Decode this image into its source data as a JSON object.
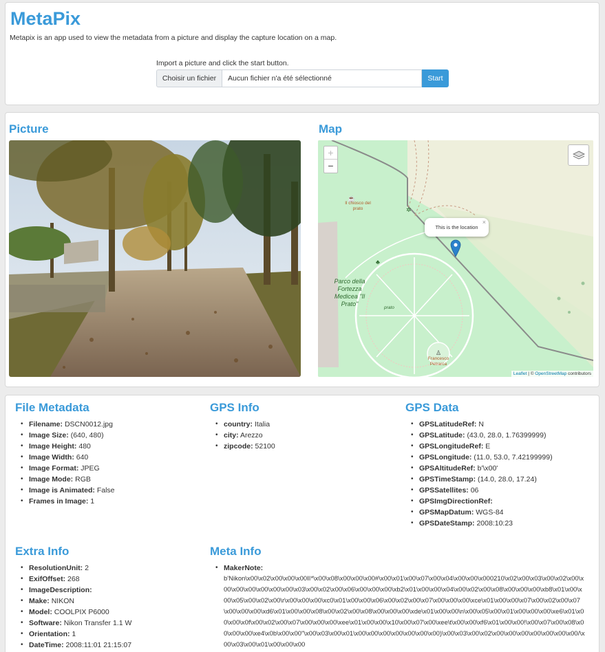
{
  "header": {
    "title": "MetaPix",
    "subtitle": "Metapix is an app used to view the metadata from a picture and display the capture location on a map.",
    "import_label": "Import a picture and click the start button.",
    "file_button": "Choisir un fichier",
    "file_name": "Aucun fichier n'a été sélectionné",
    "start_button": "Start"
  },
  "picture": {
    "heading": "Picture"
  },
  "map": {
    "heading": "Map",
    "zoom_in": "+",
    "zoom_out": "−",
    "popup_text": "This is the location",
    "popup_close": "×",
    "labels": {
      "kiosk": "Il chiosco del prato",
      "park": "Parco della Fortezza Medicea \"Il Prato\"",
      "prato": "prato",
      "statue": "Francesco Petrarca"
    },
    "attribution_leaflet": "Leaflet",
    "attribution_sep": " | © ",
    "attribution_osm": "OpenStreetMap",
    "attribution_tail": " contributors"
  },
  "file_metadata": {
    "heading": "File Metadata",
    "items": [
      {
        "k": "Filename:",
        "v": "DSCN0012.jpg"
      },
      {
        "k": "Image Size:",
        "v": "(640, 480)"
      },
      {
        "k": "Image Height:",
        "v": "480"
      },
      {
        "k": "Image Width:",
        "v": "640"
      },
      {
        "k": "Image Format:",
        "v": "JPEG"
      },
      {
        "k": "Image Mode:",
        "v": "RGB"
      },
      {
        "k": "Image is Animated:",
        "v": "False"
      },
      {
        "k": "Frames in Image:",
        "v": "1"
      }
    ]
  },
  "gps_info": {
    "heading": "GPS Info",
    "items": [
      {
        "k": "country:",
        "v": "Italia"
      },
      {
        "k": "city:",
        "v": "Arezzo"
      },
      {
        "k": "zipcode:",
        "v": "52100"
      }
    ]
  },
  "gps_data": {
    "heading": "GPS Data",
    "items": [
      {
        "k": "GPSLatitudeRef:",
        "v": "N"
      },
      {
        "k": "GPSLatitude:",
        "v": "(43.0, 28.0, 1.76399999)"
      },
      {
        "k": "GPSLongitudeRef:",
        "v": "E"
      },
      {
        "k": "GPSLongitude:",
        "v": "(11.0, 53.0, 7.42199999)"
      },
      {
        "k": "GPSAltitudeRef:",
        "v": "b'\\x00'"
      },
      {
        "k": "GPSTimeStamp:",
        "v": "(14.0, 28.0, 17.24)"
      },
      {
        "k": "GPSSatellites:",
        "v": "06"
      },
      {
        "k": "GPSImgDirectionRef:",
        "v": ""
      },
      {
        "k": "GPSMapDatum:",
        "v": "WGS-84"
      },
      {
        "k": "GPSDateStamp:",
        "v": "2008:10:23"
      }
    ]
  },
  "extra_info": {
    "heading": "Extra Info",
    "items": [
      {
        "k": "ResolutionUnit:",
        "v": "2"
      },
      {
        "k": "ExifOffset:",
        "v": "268"
      },
      {
        "k": "ImageDescription:",
        "v": ""
      },
      {
        "k": "Make:",
        "v": "NIKON"
      },
      {
        "k": "Model:",
        "v": "COOLPIX P6000"
      },
      {
        "k": "Software:",
        "v": "Nikon Transfer 1.1 W"
      },
      {
        "k": "Orientation:",
        "v": "1"
      },
      {
        "k": "DateTime:",
        "v": "2008:11:01 21:15:07"
      }
    ]
  },
  "meta_info": {
    "heading": "Meta Info",
    "maker_note_key": "MakerNote:",
    "maker_note_value": "b'Nikon\\x00\\x02\\x00\\x00\\x00II*\\x00\\x08\\x00\\x00\\x00#\\x00\\x01\\x00\\x07\\x00\\x04\\x00\\x00\\x000210\\x02\\x00\\x03\\x00\\x02\\x00\\x00\\x00\\x00\\x00\\x00\\x00\\x03\\x00\\x02\\x00\\x06\\x00\\x00\\x00\\xb2\\x01\\x00\\x00\\x04\\x00\\x02\\x00\\x08\\x00\\x00\\x00\\xb8\\x01\\x00\\x00\\x05\\x00\\x02\\x00\\r\\x00\\x00\\x00\\xc0\\x01\\x00\\x00\\x06\\x00\\x02\\x00\\x07\\x00\\x00\\x00\\xce\\x01\\x00\\x00\\x07\\x00\\x02\\x00\\x07\\x00\\x00\\x00\\xd6\\x01\\x00\\x00\\x08\\x00\\x02\\x00\\x08\\x00\\x00\\x00\\xde\\x01\\x00\\x00\\n\\x00\\x05\\x00\\x01\\x00\\x00\\x00\\xe6\\x01\\x00\\x00\\x0f\\x00\\x02\\x00\\x07\\x00\\x00\\x00\\xee\\x01\\x00\\x00\\x10\\x00\\x07\\x00\\xee\\t\\x00\\x00\\xf6\\x01\\x00\\x00!\\x00\\x07\\x00\\x08\\x00\\x00\\x00\\xe4\\x0b\\x00\\x00\"\\x00\\x03\\x00\\x01\\x00\\x00\\x00\\x00\\x00\\x00\\x00)\\x00\\x03\\x00\\x02\\x00\\x00\\x00\\x00\\x00\\x00\\x00/\\x00\\x03\\x00\\x01\\x00\\x00\\x00"
  }
}
